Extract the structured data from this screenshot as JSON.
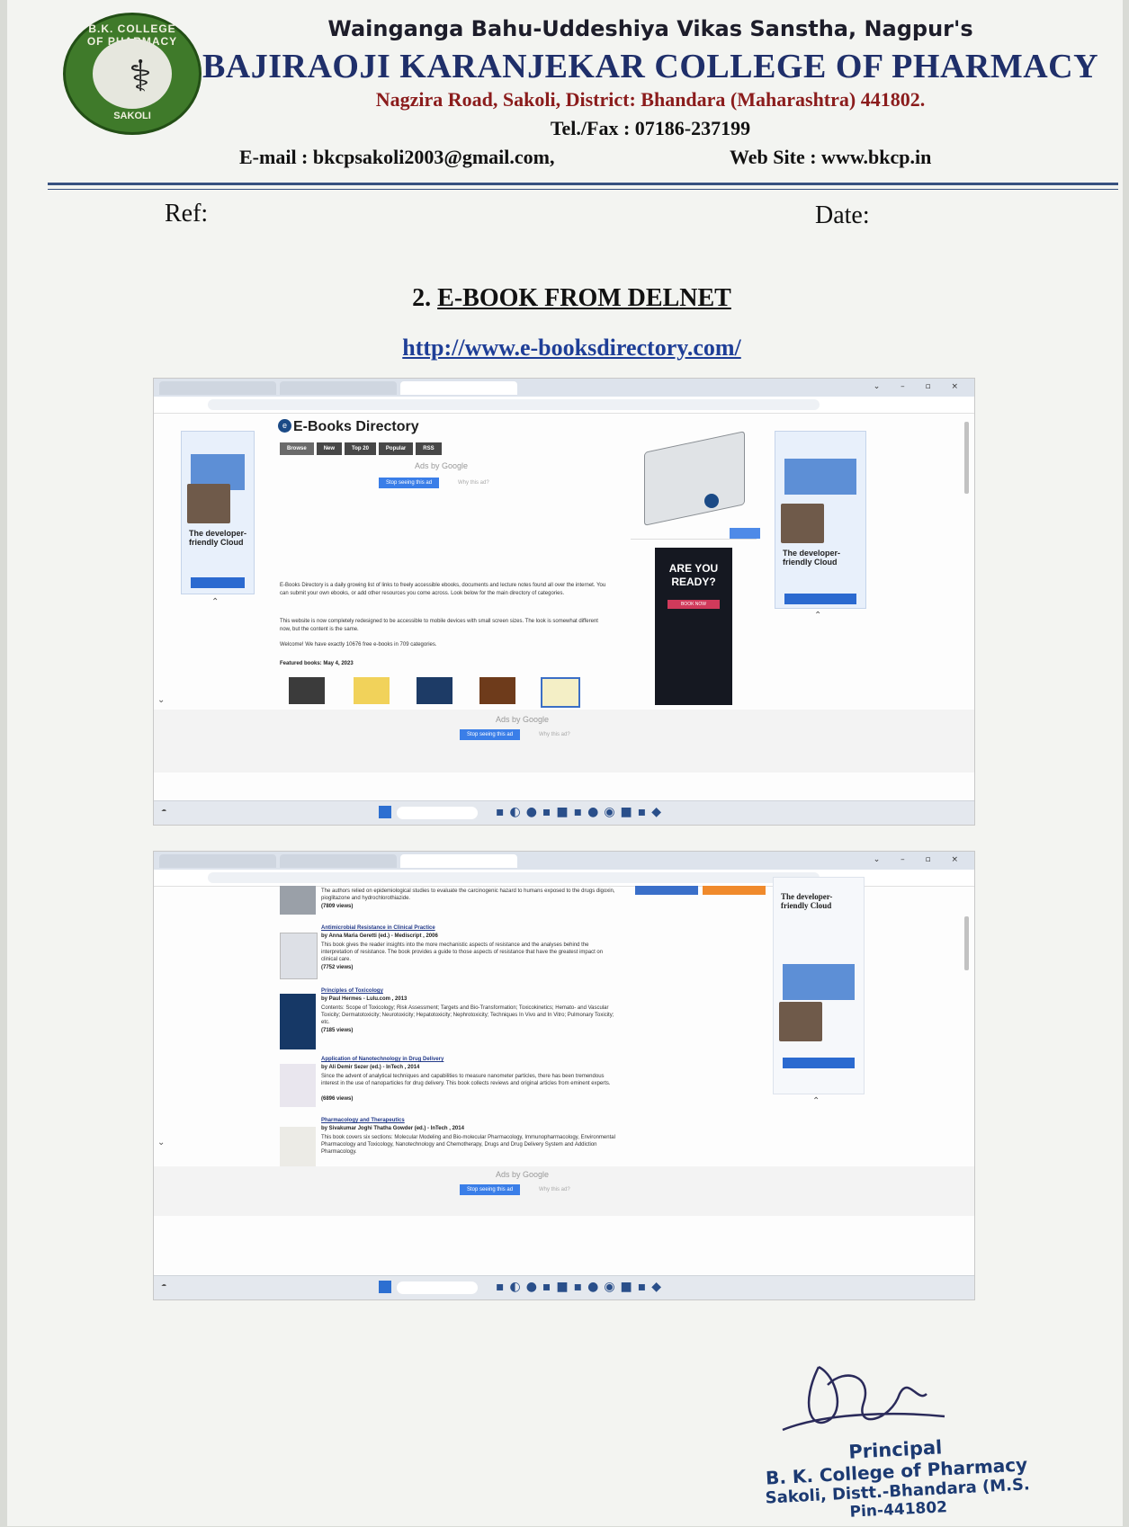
{
  "letterhead": {
    "org": "Wainganga Bahu-Uddeshiya Vikas Sanstha, Nagpur's",
    "college": "BAJIRAOJI KARANJEKAR COLLEGE OF PHARMACY",
    "address": "Nagzira Road, Sakoli, District: Bhandara (Maharashtra) 441802.",
    "telfax": "Tel./Fax : 07186-237199",
    "email": "E-mail : bkcpsakoli2003@gmail.com,",
    "website": "Web Site : www.bkcp.in",
    "logo_ring_top": "B.K. COLLEGE OF PHARMACY",
    "logo_ring_bottom": "SAKOLI"
  },
  "ref_label": "Ref:",
  "date_label": "Date:",
  "section": {
    "number": "2.",
    "title": "E-BOOK FROM DELNET",
    "url": "http://www.e-booksdirectory.com/"
  },
  "screenshot1": {
    "site_title": "E-Books Directory",
    "nav_tabs": [
      "Browse",
      "New",
      "Top 20",
      "Popular",
      "RSS"
    ],
    "ads_by": "Ads by Google",
    "ad_stop": "Stop seeing this ad",
    "ad_why": "Why this ad?",
    "side_ad_text": "The developer-friendly Cloud",
    "dark_ad_text": "ARE YOU READY?",
    "dark_ad_button": "BOOK NOW",
    "intro": "E-Books Directory is a daily growing list of links to freely accessible ebooks, documents and lecture notes found all over the internet. You can submit your own ebooks, or add other resources you come across. Look below for the main directory of categories.",
    "redesign": "This website is now completely redesigned to be accessible to mobile devices with small screen sizes. The look is somewhat different now, but the content is the same.",
    "welcome": "Welcome! We have exactly 10676 free e-books in 709 categories.",
    "featured": "Featured books: May 4, 2023"
  },
  "screenshot2": {
    "side_ad_text": "The developer-friendly Cloud",
    "books": [
      {
        "title": "",
        "by": "",
        "desc": "The authors relied on epidemiological studies to evaluate the carcinogenic hazard to humans exposed to the drugs digoxin, pioglitazone and hydrochlorothiazide.",
        "views": "(7809 views)"
      },
      {
        "title": "Antimicrobial Resistance in Clinical Practice",
        "by": "by Anna Maria Geretti (ed.) - Mediscript , 2006",
        "desc": "This book gives the reader insights into the more mechanistic aspects of resistance and the analyses behind the interpretation of resistance. The book provides a guide to those aspects of resistance that have the greatest impact on clinical care.",
        "views": "(7752 views)"
      },
      {
        "title": "Principles of Toxicology",
        "by": "by Paul Hermes - Lulu.com , 2013",
        "desc": "Contents: Scope of Toxicology; Risk Assessment; Targets and Bio-Transformation; Toxicokinetics; Hemato- and Vascular Toxicity; Dermatotoxicity; Neurotoxicity; Hepatotoxicity; Nephrotoxicity; Techniques In Vivo and In Vitro; Pulmonary Toxicity; etc.",
        "views": "(7185 views)"
      },
      {
        "title": "Application of Nanotechnology in Drug Delivery",
        "by": "by Ali Demir Sezer (ed.) - InTech , 2014",
        "desc": "Since the advent of analytical techniques and capabilities to measure nanometer particles, there has been tremendous interest in the use of nanoparticles for drug delivery. This book collects reviews and original articles from eminent experts.",
        "views": "(6896 views)"
      },
      {
        "title": "Pharmacology and Therapeutics",
        "by": "by Sivakumar Joghi Thatha Gowder (ed.) - InTech , 2014",
        "desc": "This book covers six sections: Molecular Modeling and Bio-molecular Pharmacology, Immunopharmacology, Environmental Pharmacology and Toxicology, Nanotechnology and Chemotherapy, Drugs and Drug Delivery System and Addiction Pharmacology.",
        "views": ""
      }
    ],
    "ads_by": "Ads by Google",
    "ad_stop": "Stop seeing this ad",
    "ad_why": "Why this ad?"
  },
  "signature": {
    "title": "Principal",
    "line1": "B. K. College of Pharmacy",
    "line2": "Sakoli, Distt.-Bhandara (M.S.",
    "line3": "Pin-441802"
  },
  "colors": {
    "heading_blue": "#1f2f6a",
    "address_red": "#8b1c1c",
    "url_blue": "#1e3e97",
    "stamp_blue": "#1c3a72"
  }
}
